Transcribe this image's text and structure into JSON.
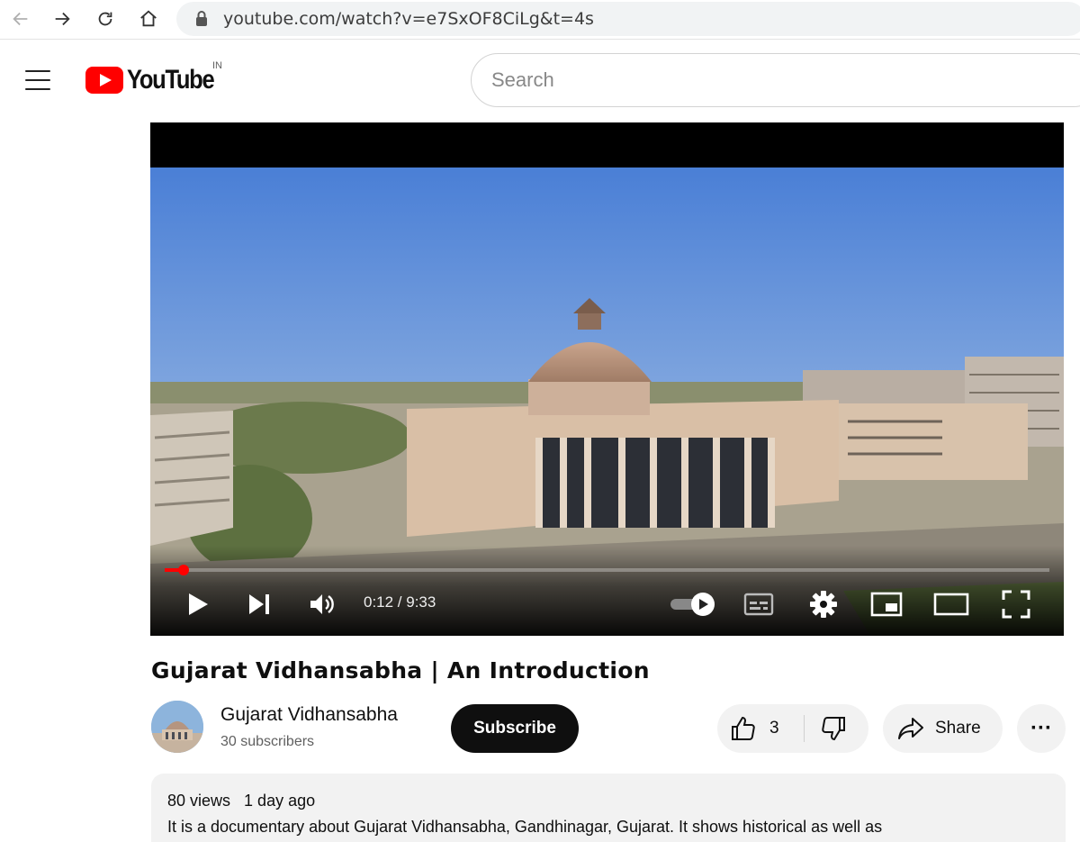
{
  "browser": {
    "url": "youtube.com/watch?v=e7SxOF8CiLg&t=4s",
    "icons": [
      "back-arrow-icon",
      "forward-arrow-icon",
      "reload-icon",
      "home-icon",
      "lock-icon"
    ]
  },
  "header": {
    "logo_text": "YouTube",
    "country_code": "IN",
    "search_placeholder": "Search"
  },
  "player": {
    "current_time": "0:12",
    "duration": "9:33",
    "time_display": "0:12 / 9:33",
    "progress_fraction": 0.021,
    "autoplay_on": true,
    "control_icons": [
      "play-icon",
      "next-icon",
      "volume-icon",
      "autoplay-toggle",
      "subtitles-icon",
      "settings-icon",
      "miniplayer-icon",
      "theater-icon",
      "fullscreen-icon"
    ]
  },
  "video": {
    "title": "Gujarat Vidhansabha | An Introduction",
    "channel": "Gujarat Vidhansabha",
    "subscribers": "30 subscribers",
    "subscribe_label": "Subscribe",
    "likes": "3",
    "share_label": "Share",
    "more_label": "···",
    "views": "80 views",
    "uploaded": "1 day ago",
    "description": "It is a documentary about Gujarat Vidhansabha, Gandhinagar, Gujarat. It shows historical as well as"
  },
  "colors": {
    "brand_red": "#ff0000",
    "text": "#0f0f0f",
    "secondary_text": "#606060",
    "chip_bg": "#f2f2f2"
  }
}
